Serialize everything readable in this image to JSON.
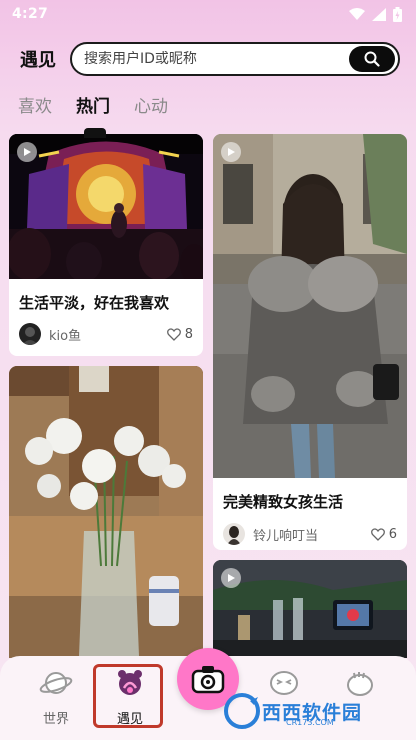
{
  "status_bar": {
    "time": "4:27"
  },
  "header": {
    "title": "遇见",
    "search_placeholder": "搜索用户ID或昵称"
  },
  "tabs": [
    {
      "label": "喜欢",
      "active": false
    },
    {
      "label": "热门",
      "active": true
    },
    {
      "label": "心动",
      "active": false
    }
  ],
  "cards": [
    {
      "title": "生活平淡，好在我喜欢",
      "author": "kio鱼",
      "likes": "8",
      "is_video": true
    },
    {
      "title": "完美精致女孩生活",
      "author": "铃儿响叮当",
      "likes": "6",
      "is_video": true
    },
    {
      "title": "",
      "author": "",
      "likes": "",
      "is_video": false
    },
    {
      "title": "",
      "author": "",
      "likes": "",
      "is_video": true
    }
  ],
  "bottom_nav": [
    {
      "label": "世界",
      "icon": "planet-icon",
      "active": false
    },
    {
      "label": "遇见",
      "icon": "meet-icon",
      "active": true
    },
    {
      "label": "",
      "icon": "camera-icon",
      "active": false
    },
    {
      "label": "",
      "icon": "chat-icon",
      "active": false
    },
    {
      "label": "",
      "icon": "profile-icon",
      "active": false
    }
  ],
  "watermark": {
    "text": "西西软件园",
    "sub": "CR173.COM"
  },
  "colors": {
    "accent_pink": "#ff77c8",
    "background": "#f6d6ee",
    "highlight_border": "#c0392b"
  }
}
